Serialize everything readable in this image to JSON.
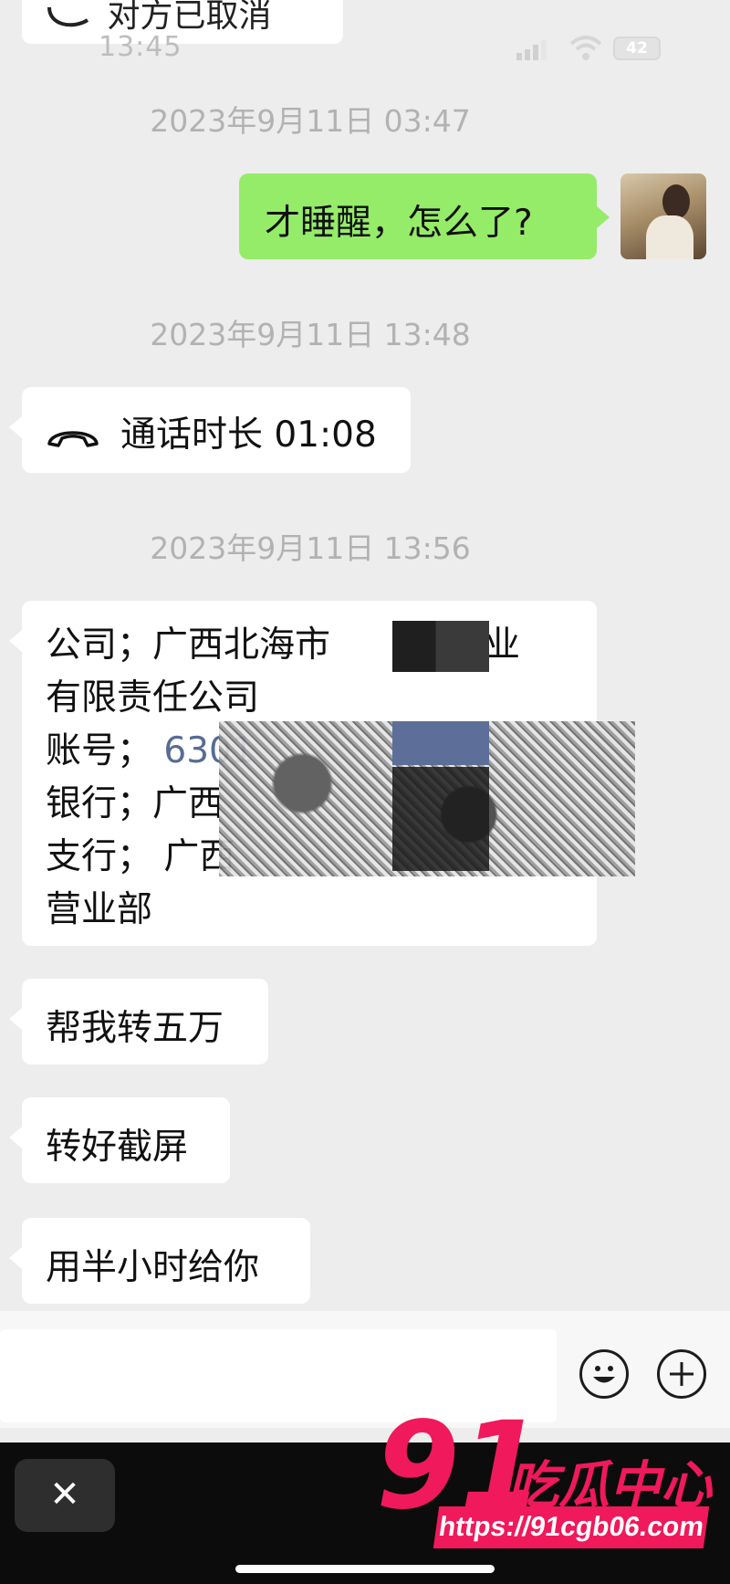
{
  "status_bar": {
    "time": "13:45",
    "battery": "42"
  },
  "chat": {
    "top_partial": "对方已取消",
    "ts1": "2023年9月11日 03:47",
    "msg_self": "才睡醒，怎么了?",
    "ts2": "2023年9月11日 13:48",
    "call_duration": "通话时长 01:08",
    "ts3": "2023年9月11日 13:56",
    "info": {
      "line1": "公司；广西北海市",
      "line1_end": "药业",
      "line2": "有限责任公司",
      "line3_label": "账号；",
      "line3_value": "6301",
      "line4": "银行；广西",
      "line5": "支行；  广西",
      "line6": "营业部"
    },
    "msg_transfer": "帮我转五万",
    "msg_screenshot": "转好截屏",
    "msg_halfhour": "用半小时给你"
  },
  "toolbar": {
    "close_label": "✕"
  },
  "watermark": {
    "num": "91",
    "name": "吃瓜中心",
    "url": "https://91cgb06.com"
  },
  "icons": [
    "phone-hangup-icon",
    "emoji-icon",
    "plus-icon",
    "close-icon",
    "signal-icon",
    "wifi-icon",
    "battery-icon"
  ],
  "colors": {
    "self_bubble": "#95ec69",
    "link": "#576b95",
    "watermark": "#f0195b"
  }
}
